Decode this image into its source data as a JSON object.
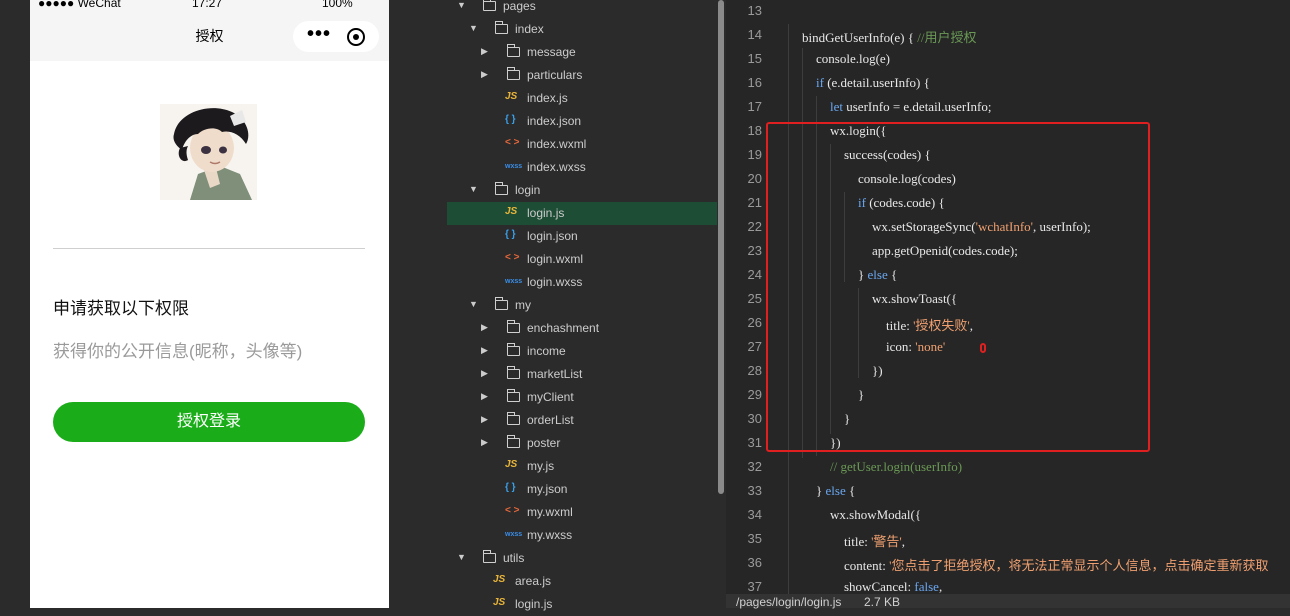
{
  "status_bar": {
    "carrier": "●●●●● WeChat",
    "time": "17:27",
    "battery": "100%"
  },
  "navbar": {
    "title": "授权"
  },
  "auth": {
    "request_title": "申请获取以下权限",
    "request_desc": "获得你的公开信息(昵称，头像等)",
    "button_label": "授权登录"
  },
  "file_tree": [
    {
      "label": "pages",
      "type": "folder",
      "expanded": true
    },
    {
      "label": "index",
      "type": "folder",
      "expanded": true
    },
    {
      "label": "message",
      "type": "folder",
      "expanded": false
    },
    {
      "label": "particulars",
      "type": "folder",
      "expanded": false
    },
    {
      "label": "index.js",
      "type": "js"
    },
    {
      "label": "index.json",
      "type": "json"
    },
    {
      "label": "index.wxml",
      "type": "wxml"
    },
    {
      "label": "index.wxss",
      "type": "wxss"
    },
    {
      "label": "login",
      "type": "folder",
      "expanded": true
    },
    {
      "label": "login.js",
      "type": "js",
      "selected": true
    },
    {
      "label": "login.json",
      "type": "json"
    },
    {
      "label": "login.wxml",
      "type": "wxml"
    },
    {
      "label": "login.wxss",
      "type": "wxss"
    },
    {
      "label": "my",
      "type": "folder",
      "expanded": true
    },
    {
      "label": "enchashment",
      "type": "folder",
      "expanded": false
    },
    {
      "label": "income",
      "type": "folder",
      "expanded": false
    },
    {
      "label": "marketList",
      "type": "folder",
      "expanded": false
    },
    {
      "label": "myClient",
      "type": "folder",
      "expanded": false
    },
    {
      "label": "orderList",
      "type": "folder",
      "expanded": false
    },
    {
      "label": "poster",
      "type": "folder",
      "expanded": false
    },
    {
      "label": "my.js",
      "type": "js"
    },
    {
      "label": "my.json",
      "type": "json"
    },
    {
      "label": "my.wxml",
      "type": "wxml"
    },
    {
      "label": "my.wxss",
      "type": "wxss"
    },
    {
      "label": "utils",
      "type": "folder",
      "expanded": true
    },
    {
      "label": "area.js",
      "type": "js"
    },
    {
      "label": "login.js",
      "type": "js"
    }
  ],
  "file_icons": {
    "js": "JS",
    "json": "{ }",
    "wxml": "< >",
    "wxss": "wxss"
  },
  "code_lines": [
    {
      "n": "13",
      "tokens": []
    },
    {
      "n": "14",
      "tokens": [
        [
          "",
          "bindGetUserInfo(e) { "
        ],
        [
          "cmt",
          "//用户授权"
        ]
      ]
    },
    {
      "n": "15",
      "tokens": [
        [
          "",
          "console.log(e)"
        ]
      ]
    },
    {
      "n": "16",
      "tokens": [
        [
          "kw",
          "if"
        ],
        [
          "",
          " (e.detail.userInfo) {"
        ]
      ]
    },
    {
      "n": "17",
      "tokens": [
        [
          "kw",
          "let"
        ],
        [
          "",
          " userInfo = e.detail.userInfo;"
        ]
      ]
    },
    {
      "n": "18",
      "tokens": [
        [
          "",
          "wx.login({"
        ]
      ]
    },
    {
      "n": "19",
      "tokens": [
        [
          "",
          "success(codes) {"
        ]
      ]
    },
    {
      "n": "20",
      "tokens": [
        [
          "",
          "console.log(codes)"
        ]
      ]
    },
    {
      "n": "21",
      "tokens": [
        [
          "kw",
          "if"
        ],
        [
          "",
          " (codes.code) {"
        ]
      ]
    },
    {
      "n": "22",
      "tokens": [
        [
          "",
          "wx.setStorageSync("
        ],
        [
          "str",
          "'wchatInfo'"
        ],
        [
          "",
          ", userInfo);"
        ]
      ]
    },
    {
      "n": "23",
      "tokens": [
        [
          "",
          "app.getOpenid(codes.code);"
        ]
      ]
    },
    {
      "n": "24",
      "tokens": [
        [
          "",
          "} "
        ],
        [
          "kw",
          "else"
        ],
        [
          "",
          " {"
        ]
      ]
    },
    {
      "n": "25",
      "tokens": [
        [
          "",
          "wx.showToast({"
        ]
      ]
    },
    {
      "n": "26",
      "tokens": [
        [
          "",
          "title: "
        ],
        [
          "str",
          "'授权失败'"
        ],
        [
          "",
          ","
        ]
      ]
    },
    {
      "n": "27",
      "tokens": [
        [
          "",
          "icon: "
        ],
        [
          "str",
          "'none'"
        ]
      ]
    },
    {
      "n": "28",
      "tokens": [
        [
          "",
          "})"
        ]
      ]
    },
    {
      "n": "29",
      "tokens": [
        [
          "",
          "}"
        ]
      ]
    },
    {
      "n": "30",
      "tokens": [
        [
          "",
          "}"
        ]
      ]
    },
    {
      "n": "31",
      "tokens": [
        [
          "",
          "})"
        ]
      ]
    },
    {
      "n": "32",
      "tokens": [
        [
          "cmt",
          "// getUser.login(userInfo)"
        ]
      ]
    },
    {
      "n": "33",
      "tokens": [
        [
          "",
          "} "
        ],
        [
          "kw",
          "else"
        ],
        [
          "",
          " {"
        ]
      ]
    },
    {
      "n": "34",
      "tokens": [
        [
          "",
          "wx.showModal({"
        ]
      ]
    },
    {
      "n": "35",
      "tokens": [
        [
          "",
          "title: "
        ],
        [
          "str",
          "'警告'"
        ],
        [
          "",
          ","
        ]
      ]
    },
    {
      "n": "36",
      "tokens": [
        [
          "",
          "content: "
        ],
        [
          "str",
          "'您点击了拒绝授权，将无法正常显示个人信息，点击确定重新获取"
        ]
      ]
    },
    {
      "n": "37",
      "tokens": [
        [
          "",
          "showCancel: "
        ],
        [
          "kw",
          "false"
        ],
        [
          "",
          ","
        ]
      ]
    }
  ],
  "editor_status": {
    "path": "/pages/login/login.js",
    "size": "2.7 KB"
  },
  "colors": {
    "accent_green": "#1aad19",
    "highlight_red": "#e02020",
    "selected_row": "#1e4d36"
  }
}
